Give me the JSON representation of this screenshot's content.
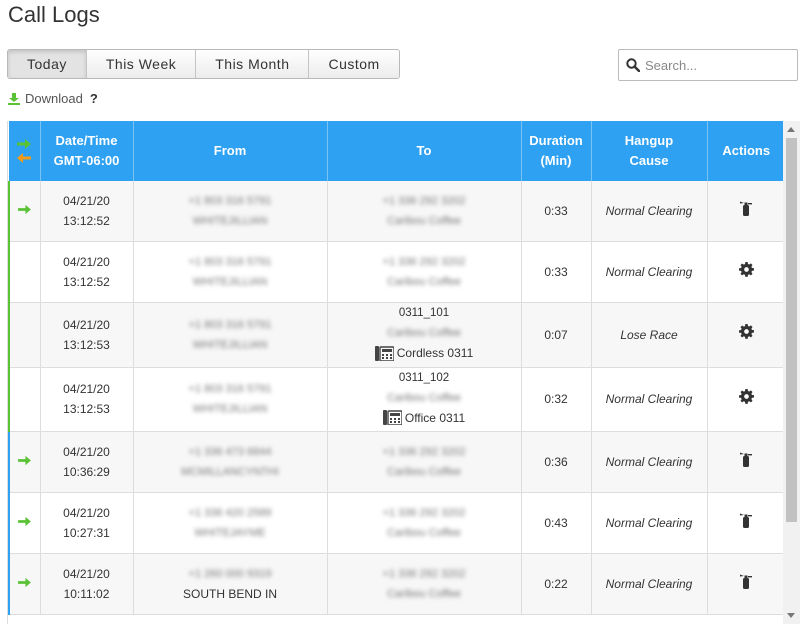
{
  "page": {
    "title": "Call Logs"
  },
  "filters": {
    "tabs": [
      "Today",
      "This Week",
      "This Month",
      "Custom"
    ],
    "active": "Today"
  },
  "search": {
    "placeholder": "Search...",
    "value": ""
  },
  "download": {
    "label": "Download",
    "help": "?"
  },
  "colors": {
    "header": "#2ea1f2",
    "inbound": "#5bc236",
    "outbound": "#f29c1a",
    "internal_indicator": "#5bc236",
    "external_indicator": "#2ea1f2"
  },
  "table": {
    "headers": {
      "direction": "",
      "datetime_line1": "Date/Time",
      "datetime_line2": "GMT-06:00",
      "from": "From",
      "to": "To",
      "duration_line1": "Duration",
      "duration_line2": "(Min)",
      "hangup_line1": "Hangup",
      "hangup_line2": "Cause",
      "actions": "Actions"
    },
    "rows": [
      {
        "icon": "arrow-right-icon",
        "date": "04/21/20",
        "time": "13:12:52",
        "from_number": "+1 803 316 5791",
        "from_name": "WHITEJILLIAN",
        "to_ext": "",
        "to_number": "+1 336 292 3202",
        "to_name": "Caribou Coffee",
        "to_device": "",
        "duration": "0:33",
        "cause": "Normal Clearing",
        "action_icon": "fire-extinguisher-icon"
      },
      {
        "icon": "",
        "date": "04/21/20",
        "time": "13:12:52",
        "from_number": "+1 803 316 5791",
        "from_name": "WHITEJILLIAN",
        "to_ext": "",
        "to_number": "+1 336 292 3202",
        "to_name": "Caribou Coffee",
        "to_device": "",
        "duration": "0:33",
        "cause": "Normal Clearing",
        "action_icon": "gear-icon"
      },
      {
        "icon": "",
        "date": "04/21/20",
        "time": "13:12:53",
        "from_number": "+1 803 316 5791",
        "from_name": "WHITEJILLIAN",
        "to_ext": "0311_101",
        "to_number": "",
        "to_name": "Caribou Coffee",
        "to_device": "Cordless 0311",
        "duration": "0:07",
        "cause": "Lose Race",
        "action_icon": "gear-icon"
      },
      {
        "icon": "",
        "date": "04/21/20",
        "time": "13:12:53",
        "from_number": "+1 803 316 5791",
        "from_name": "WHITEJILLIAN",
        "to_ext": "0311_102",
        "to_number": "",
        "to_name": "Caribou Coffee",
        "to_device": "Office 0311",
        "duration": "0:32",
        "cause": "Normal Clearing",
        "action_icon": "gear-icon"
      },
      {
        "icon": "arrow-right-icon",
        "date": "04/21/20",
        "time": "10:36:29",
        "from_number": "+1 336 473 6844",
        "from_name": "MCMILLANCYNTHI",
        "to_ext": "",
        "to_number": "+1 336 292 3202",
        "to_name": "Caribou Coffee",
        "to_device": "",
        "duration": "0:36",
        "cause": "Normal Clearing",
        "action_icon": "fire-extinguisher-icon"
      },
      {
        "icon": "arrow-right-icon",
        "date": "04/21/20",
        "time": "10:27:31",
        "from_number": "+1 336 420 2589",
        "from_name": "WHITEJAYME",
        "to_ext": "",
        "to_number": "+1 336 292 3202",
        "to_name": "Caribou Coffee",
        "to_device": "",
        "duration": "0:43",
        "cause": "Normal Clearing",
        "action_icon": "fire-extinguisher-icon"
      },
      {
        "icon": "arrow-right-icon",
        "date": "04/21/20",
        "time": "10:11:02",
        "from_number": "+1 260 000 9319",
        "from_name": "SOUTH BEND IN",
        "to_ext": "",
        "to_number": "+1 336 292 3202",
        "to_name": "Caribou Coffee",
        "to_device": "",
        "duration": "0:22",
        "cause": "Normal Clearing",
        "action_icon": "fire-extinguisher-icon"
      }
    ]
  }
}
